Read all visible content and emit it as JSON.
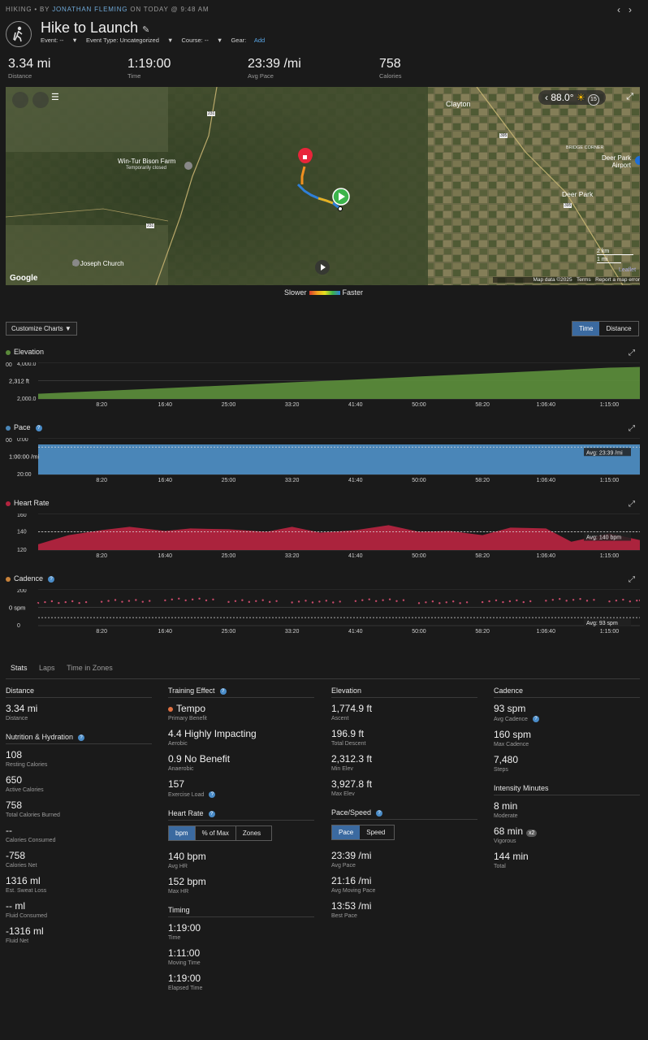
{
  "header": {
    "activity_type": "HIKING",
    "by": "• BY",
    "author": "JONATHAN FLEMING",
    "when": "ON TODAY @ 9:48 AM",
    "title": "Hike to Launch",
    "event_label": "Event: --",
    "event_type_label": "Event Type: Uncategorized",
    "course_label": "Course: --",
    "gear_label": "Gear:",
    "gear_link": "Add"
  },
  "summary": [
    {
      "value": "3.34 mi",
      "label": "Distance"
    },
    {
      "value": "1:19:00",
      "label": "Time"
    },
    {
      "value": "23:39 /mi",
      "label": "Avg Pace"
    },
    {
      "value": "758",
      "label": "Calories"
    }
  ],
  "map": {
    "places": [
      "Clayton",
      "Win-Tur Bison Farm",
      "Temporarily closed",
      "Deer Park",
      "Deer Park Airport",
      "St Joseph Church",
      "BRIDGE CORNER"
    ],
    "route_nums": [
      "231",
      "231",
      "395",
      "395"
    ],
    "temperature": "88.0°",
    "zoom_badge": "15",
    "scale_km": "2 km",
    "scale_mi": "1 mi",
    "attribution": "Map data ©2025",
    "terms": "Terms",
    "report": "Report a map error",
    "leaflet": "Leaflet",
    "google": "Google"
  },
  "legend": {
    "slower": "Slower",
    "faster": "Faster"
  },
  "controls": {
    "customize": "Customize Charts",
    "time": "Time",
    "distance": "Distance"
  },
  "x_ticks": [
    "8:20",
    "16:40",
    "25:00",
    "33:20",
    "41:40",
    "50:00",
    "58:20",
    "1:06:40",
    "1:15:00"
  ],
  "chart_data": [
    {
      "type": "area",
      "title": "Elevation",
      "y_ticks": [
        "4,000.0",
        "2,000.0"
      ],
      "y_cut": "00",
      "y_marker": "2,312 ft",
      "x": [
        0,
        8.33,
        16.67,
        25,
        33.33,
        41.67,
        50,
        58.33,
        66.67,
        75,
        79
      ],
      "values": [
        2312,
        2480,
        2650,
        2820,
        3000,
        3170,
        3350,
        3520,
        3700,
        3880,
        3928
      ],
      "ylim": [
        2000,
        4200
      ],
      "color": "#5a8a3a"
    },
    {
      "type": "area",
      "title": "Pace",
      "y_ticks": [
        "0:00",
        "20:00"
      ],
      "y_cut": "00",
      "y_marker": "1:00:00 /mi",
      "avg_label": "Avg: 23:39 /mi",
      "x": [
        0,
        2,
        8.33,
        16.67,
        25,
        33.33,
        41.67,
        50,
        58.33,
        66.67,
        75,
        79
      ],
      "values": [
        60,
        24,
        23,
        24,
        23,
        25,
        24,
        22,
        23,
        24,
        22,
        23
      ],
      "ylim": [
        0,
        70
      ],
      "inverted": true,
      "color": "#4a86b8"
    },
    {
      "type": "area",
      "title": "Heart Rate",
      "y_ticks": [
        "160",
        "140",
        "120"
      ],
      "avg_label": "Avg: 140 bpm",
      "x": [
        0,
        4,
        8.33,
        12,
        16.67,
        20,
        25,
        30,
        33.33,
        37,
        41.67,
        46,
        50,
        54,
        58.33,
        62,
        66.67,
        70,
        75,
        79
      ],
      "values": [
        125,
        136,
        142,
        146,
        141,
        144,
        143,
        140,
        146,
        139,
        142,
        148,
        140,
        141,
        136,
        145,
        144,
        128,
        138,
        130
      ],
      "ylim": [
        118,
        162
      ],
      "color": "#b3243f"
    },
    {
      "type": "scatter",
      "title": "Cadence",
      "y_ticks": [
        "200",
        "150",
        "0"
      ],
      "y_marker": "0 spm",
      "avg_label": "Avg: 93 spm",
      "x": [
        0,
        8.33,
        16.67,
        25,
        33.33,
        41.67,
        50,
        58.33,
        66.67,
        75,
        79
      ],
      "values": [
        135,
        142,
        150,
        141,
        138,
        146,
        134,
        140,
        148,
        144,
        150
      ],
      "ylim": [
        0,
        210
      ],
      "color": "#c84a6a"
    }
  ],
  "tabs": [
    "Stats",
    "Laps",
    "Time in Zones"
  ],
  "stats": {
    "distance": {
      "title": "Distance",
      "items": [
        {
          "value": "3.34 mi",
          "label": "Distance"
        }
      ]
    },
    "nutrition": {
      "title": "Nutrition & Hydration",
      "items": [
        {
          "value": "108",
          "label": "Resting Calories"
        },
        {
          "value": "650",
          "label": "Active Calories"
        },
        {
          "value": "758",
          "label": "Total Calories Burned"
        },
        {
          "value": "--",
          "label": "Calories Consumed"
        },
        {
          "value": "-758",
          "label": "Calories Net"
        },
        {
          "value": "1316 ml",
          "label": "Est. Sweat Loss"
        },
        {
          "value": "-- ml",
          "label": "Fluid Consumed"
        },
        {
          "value": "-1316 ml",
          "label": "Fluid Net"
        }
      ]
    },
    "training": {
      "title": "Training Effect",
      "items": [
        {
          "value": "Tempo",
          "label": "Primary Benefit"
        },
        {
          "value": "4.4 Highly Impacting",
          "label": "Aerobic"
        },
        {
          "value": "0.9 No Benefit",
          "label": "Anaerobic"
        },
        {
          "value": "157",
          "label": "Exercise Load"
        }
      ]
    },
    "heart": {
      "title": "Heart Rate",
      "seg": [
        "bpm",
        "% of Max",
        "Zones"
      ],
      "items": [
        {
          "value": "140 bpm",
          "label": "Avg HR"
        },
        {
          "value": "152 bpm",
          "label": "Max HR"
        }
      ]
    },
    "timing": {
      "title": "Timing",
      "items": [
        {
          "value": "1:19:00",
          "label": "Time"
        },
        {
          "value": "1:11:00",
          "label": "Moving Time"
        },
        {
          "value": "1:19:00",
          "label": "Elapsed Time"
        }
      ]
    },
    "elevation": {
      "title": "Elevation",
      "items": [
        {
          "value": "1,774.9 ft",
          "label": "Ascent"
        },
        {
          "value": "196.9 ft",
          "label": "Total Descent"
        },
        {
          "value": "2,312.3 ft",
          "label": "Min Elev"
        },
        {
          "value": "3,927.8 ft",
          "label": "Max Elev"
        }
      ]
    },
    "pace": {
      "title": "Pace/Speed",
      "seg": [
        "Pace",
        "Speed"
      ],
      "items": [
        {
          "value": "23:39 /mi",
          "label": "Avg Pace"
        },
        {
          "value": "21:16 /mi",
          "label": "Avg Moving Pace"
        },
        {
          "value": "13:53 /mi",
          "label": "Best Pace"
        }
      ]
    },
    "cadence": {
      "title": "Cadence",
      "items": [
        {
          "value": "93 spm",
          "label": "Avg Cadence"
        },
        {
          "value": "160 spm",
          "label": "Max Cadence"
        },
        {
          "value": "7,480",
          "label": "Steps"
        }
      ]
    },
    "intensity": {
      "title": "Intensity Minutes",
      "badge": "x2",
      "items": [
        {
          "value": "8 min",
          "label": "Moderate"
        },
        {
          "value": "68 min",
          "label": "Vigorous"
        },
        {
          "value": "144 min",
          "label": "Total"
        }
      ]
    }
  }
}
